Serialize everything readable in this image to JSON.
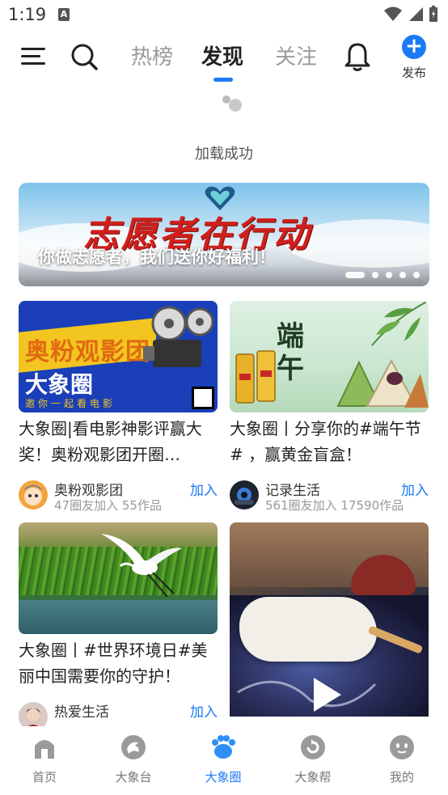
{
  "status_bar": {
    "time": "1:19",
    "notification_glyph": "A"
  },
  "top_nav": {
    "tabs": [
      {
        "label": "热榜"
      },
      {
        "label": "发现"
      },
      {
        "label": "关注"
      }
    ],
    "publish_label": "发布",
    "accent_color": "#1b7bf5"
  },
  "feed": {
    "load_status": "加载成功"
  },
  "banner": {
    "title": "志愿者在行动",
    "caption": "你做志愿者，我们送你好福利！",
    "dot_count": 5,
    "active_dot": 0
  },
  "cards": [
    {
      "title": "大象圈|看电影神影评赢大奖！奥粉观影团开圈…",
      "poster_text": "奥粉观影团",
      "poster_sub": "大象圈",
      "poster_slogan": "邀你一起看电影",
      "community": "奥粉观影团",
      "stats": "47圈友加入  55作品",
      "join_label": "加入"
    },
    {
      "title": "大象圈丨分享你的#端午节# ，赢黄金盲盒！",
      "poster_text": "端午",
      "community": "记录生活",
      "stats": "561圈友加入  17590作品",
      "join_label": "加入"
    },
    {
      "title": "大象圈丨#世界环境日#美丽中国需要你的守护！",
      "community": "热爱生活",
      "stats": "",
      "join_label": "加入"
    },
    {
      "title": "",
      "community": "",
      "stats": "",
      "join_label": ""
    }
  ],
  "bottom_nav": {
    "items": [
      {
        "label": "首页",
        "icon": "home-icon"
      },
      {
        "label": "大象台",
        "icon": "radio-icon"
      },
      {
        "label": "大象圈",
        "icon": "paw-icon",
        "active": true
      },
      {
        "label": "大象帮",
        "icon": "help-icon"
      },
      {
        "label": "我的",
        "icon": "face-icon"
      }
    ]
  }
}
